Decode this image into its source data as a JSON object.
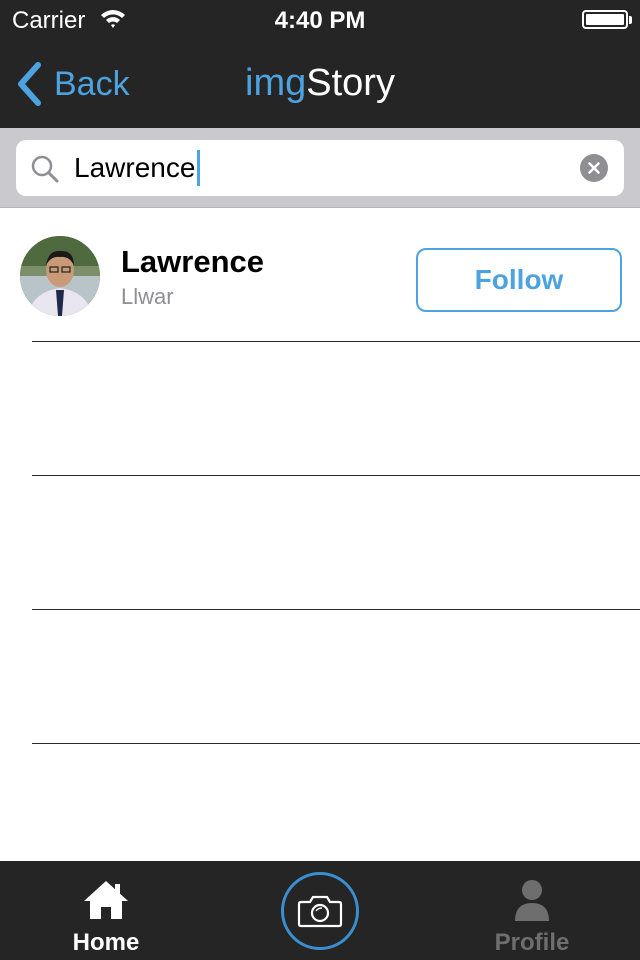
{
  "status": {
    "carrier": "Carrier",
    "time": "4:40 PM"
  },
  "nav": {
    "back_label": "Back",
    "title_part1": "img",
    "title_part2": "Story"
  },
  "search": {
    "value": "Lawrence"
  },
  "results": [
    {
      "name": "Lawrence",
      "handle": "Llwar",
      "follow_label": "Follow"
    }
  ],
  "tabs": {
    "home_label": "Home",
    "profile_label": "Profile"
  },
  "colors": {
    "accent": "#4da3e0",
    "bar_bg": "#252525",
    "inactive": "#6e6e6e"
  }
}
